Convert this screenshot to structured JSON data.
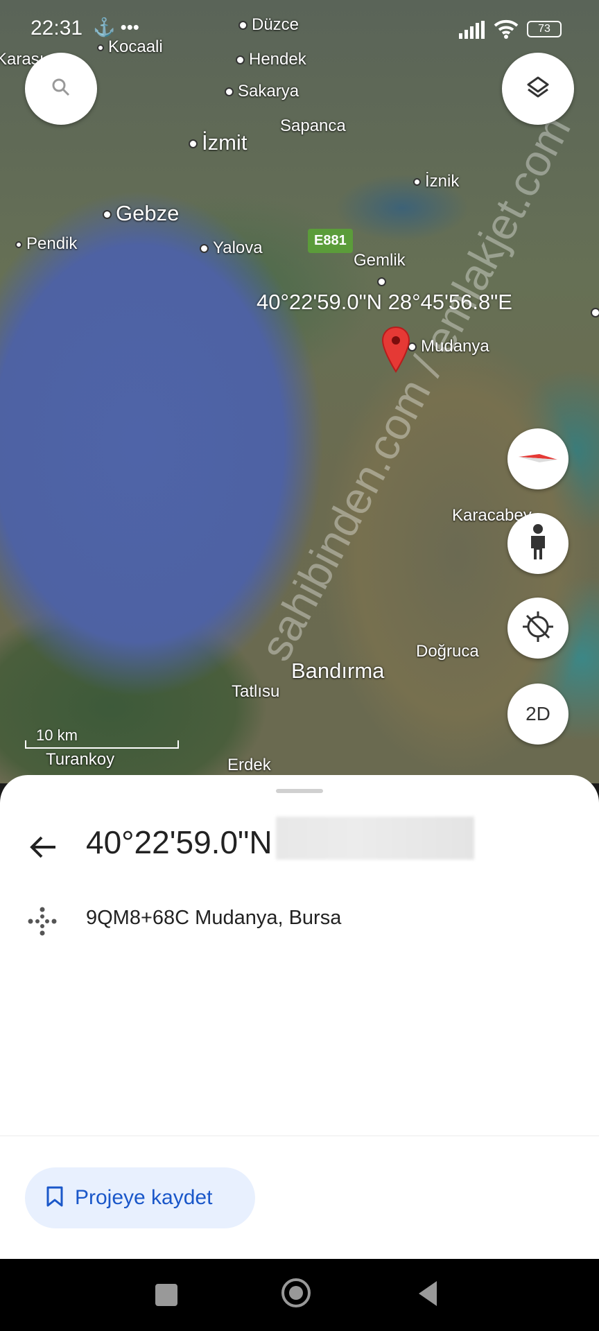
{
  "status_bar": {
    "time": "22:31",
    "battery": "73"
  },
  "map": {
    "labels": [
      {
        "id": "duzce",
        "text": "Düzce"
      },
      {
        "id": "kocaali",
        "text": "Kocaali"
      },
      {
        "id": "karasu",
        "text": "Karası"
      },
      {
        "id": "hendek",
        "text": "Hendek"
      },
      {
        "id": "sakarya",
        "text": "Sakarya"
      },
      {
        "id": "sapanca",
        "text": "Sapanca"
      },
      {
        "id": "izmit",
        "text": "İzmit"
      },
      {
        "id": "iznik",
        "text": "İznik"
      },
      {
        "id": "gebze",
        "text": "Gebze"
      },
      {
        "id": "pendik",
        "text": "Pendik"
      },
      {
        "id": "yalova",
        "text": "Yalova"
      },
      {
        "id": "gemlik",
        "text": "Gemlik"
      },
      {
        "id": "mudanya",
        "text": "Mudanya"
      },
      {
        "id": "karacabey",
        "text": "Karacabey"
      },
      {
        "id": "dogruca",
        "text": "Doğruca"
      },
      {
        "id": "bandirma",
        "text": "Bandırma"
      },
      {
        "id": "tatlisu",
        "text": "Tatlısu"
      },
      {
        "id": "turankoy",
        "text": "Turankoy"
      },
      {
        "id": "erdek",
        "text": "Erdek"
      }
    ],
    "road_shield": "E881",
    "pin_coordinates": "40°22'59.0\"N 28°45'56.8\"E",
    "scale_label": "10 km",
    "watermark": "sahibinden.com / emlakjet.com",
    "view_toggle_label": "2D",
    "colors": {
      "water": "#4e62a3",
      "pin": "#e53935"
    }
  },
  "sheet": {
    "title": "40°22'59.0\"N",
    "plus_code": "9QM8+68C Mudanya, Bursa",
    "save_button_label": "Projeye kaydet",
    "accent_color": "#1a57c9"
  },
  "icons": {
    "search": "search-icon",
    "layers": "layers-icon",
    "compass": "compass-icon",
    "pegman": "pegman-icon",
    "locate": "my-location-icon",
    "back": "back-arrow-icon",
    "pluscode": "plus-code-icon",
    "bookmark": "bookmark-icon"
  }
}
